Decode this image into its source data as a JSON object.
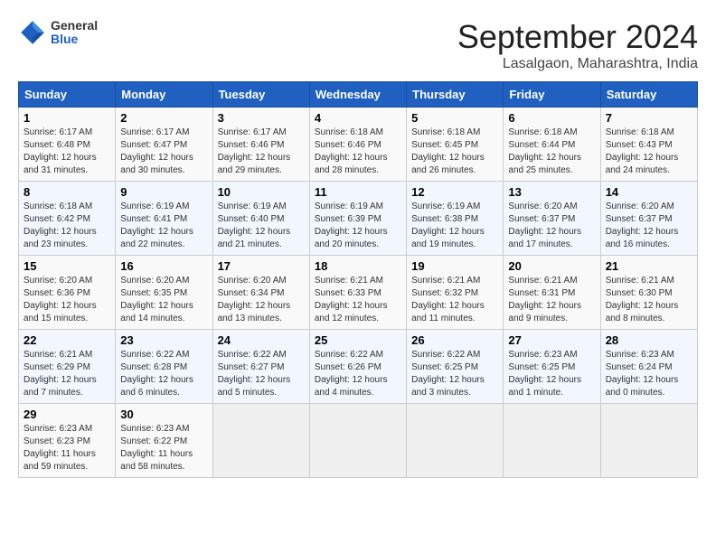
{
  "header": {
    "logo_general": "General",
    "logo_blue": "Blue",
    "month_title": "September 2024",
    "location": "Lasalgaon, Maharashtra, India"
  },
  "days_of_week": [
    "Sunday",
    "Monday",
    "Tuesday",
    "Wednesday",
    "Thursday",
    "Friday",
    "Saturday"
  ],
  "weeks": [
    [
      {
        "day": "1",
        "sunrise": "6:17 AM",
        "sunset": "6:48 PM",
        "daylight": "12 hours and 31 minutes."
      },
      {
        "day": "2",
        "sunrise": "6:17 AM",
        "sunset": "6:47 PM",
        "daylight": "12 hours and 30 minutes."
      },
      {
        "day": "3",
        "sunrise": "6:17 AM",
        "sunset": "6:46 PM",
        "daylight": "12 hours and 29 minutes."
      },
      {
        "day": "4",
        "sunrise": "6:18 AM",
        "sunset": "6:46 PM",
        "daylight": "12 hours and 28 minutes."
      },
      {
        "day": "5",
        "sunrise": "6:18 AM",
        "sunset": "6:45 PM",
        "daylight": "12 hours and 26 minutes."
      },
      {
        "day": "6",
        "sunrise": "6:18 AM",
        "sunset": "6:44 PM",
        "daylight": "12 hours and 25 minutes."
      },
      {
        "day": "7",
        "sunrise": "6:18 AM",
        "sunset": "6:43 PM",
        "daylight": "12 hours and 24 minutes."
      }
    ],
    [
      {
        "day": "8",
        "sunrise": "6:18 AM",
        "sunset": "6:42 PM",
        "daylight": "12 hours and 23 minutes."
      },
      {
        "day": "9",
        "sunrise": "6:19 AM",
        "sunset": "6:41 PM",
        "daylight": "12 hours and 22 minutes."
      },
      {
        "day": "10",
        "sunrise": "6:19 AM",
        "sunset": "6:40 PM",
        "daylight": "12 hours and 21 minutes."
      },
      {
        "day": "11",
        "sunrise": "6:19 AM",
        "sunset": "6:39 PM",
        "daylight": "12 hours and 20 minutes."
      },
      {
        "day": "12",
        "sunrise": "6:19 AM",
        "sunset": "6:38 PM",
        "daylight": "12 hours and 19 minutes."
      },
      {
        "day": "13",
        "sunrise": "6:20 AM",
        "sunset": "6:37 PM",
        "daylight": "12 hours and 17 minutes."
      },
      {
        "day": "14",
        "sunrise": "6:20 AM",
        "sunset": "6:37 PM",
        "daylight": "12 hours and 16 minutes."
      }
    ],
    [
      {
        "day": "15",
        "sunrise": "6:20 AM",
        "sunset": "6:36 PM",
        "daylight": "12 hours and 15 minutes."
      },
      {
        "day": "16",
        "sunrise": "6:20 AM",
        "sunset": "6:35 PM",
        "daylight": "12 hours and 14 minutes."
      },
      {
        "day": "17",
        "sunrise": "6:20 AM",
        "sunset": "6:34 PM",
        "daylight": "12 hours and 13 minutes."
      },
      {
        "day": "18",
        "sunrise": "6:21 AM",
        "sunset": "6:33 PM",
        "daylight": "12 hours and 12 minutes."
      },
      {
        "day": "19",
        "sunrise": "6:21 AM",
        "sunset": "6:32 PM",
        "daylight": "12 hours and 11 minutes."
      },
      {
        "day": "20",
        "sunrise": "6:21 AM",
        "sunset": "6:31 PM",
        "daylight": "12 hours and 9 minutes."
      },
      {
        "day": "21",
        "sunrise": "6:21 AM",
        "sunset": "6:30 PM",
        "daylight": "12 hours and 8 minutes."
      }
    ],
    [
      {
        "day": "22",
        "sunrise": "6:21 AM",
        "sunset": "6:29 PM",
        "daylight": "12 hours and 7 minutes."
      },
      {
        "day": "23",
        "sunrise": "6:22 AM",
        "sunset": "6:28 PM",
        "daylight": "12 hours and 6 minutes."
      },
      {
        "day": "24",
        "sunrise": "6:22 AM",
        "sunset": "6:27 PM",
        "daylight": "12 hours and 5 minutes."
      },
      {
        "day": "25",
        "sunrise": "6:22 AM",
        "sunset": "6:26 PM",
        "daylight": "12 hours and 4 minutes."
      },
      {
        "day": "26",
        "sunrise": "6:22 AM",
        "sunset": "6:25 PM",
        "daylight": "12 hours and 3 minutes."
      },
      {
        "day": "27",
        "sunrise": "6:23 AM",
        "sunset": "6:25 PM",
        "daylight": "12 hours and 1 minute."
      },
      {
        "day": "28",
        "sunrise": "6:23 AM",
        "sunset": "6:24 PM",
        "daylight": "12 hours and 0 minutes."
      }
    ],
    [
      {
        "day": "29",
        "sunrise": "6:23 AM",
        "sunset": "6:23 PM",
        "daylight": "11 hours and 59 minutes."
      },
      {
        "day": "30",
        "sunrise": "6:23 AM",
        "sunset": "6:22 PM",
        "daylight": "11 hours and 58 minutes."
      },
      null,
      null,
      null,
      null,
      null
    ]
  ]
}
